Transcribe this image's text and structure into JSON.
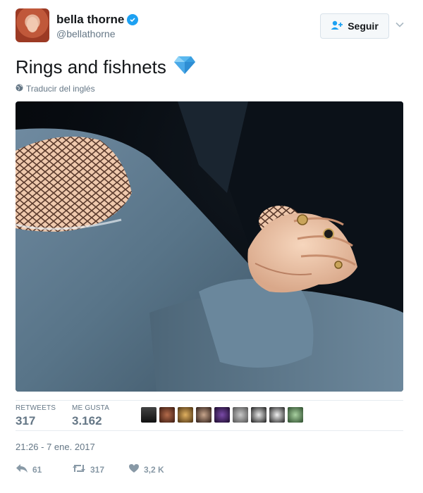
{
  "user": {
    "display_name": "bella thorne",
    "handle": "@bellathorne",
    "avatar_icon": "profile-avatar",
    "verified_icon": "verified-badge-icon"
  },
  "follow_button": {
    "label": "Seguir",
    "icon": "add-user-icon"
  },
  "tweet": {
    "text": "Rings and fishnets",
    "emoji": "💎",
    "translate_label": "Traducir del inglés"
  },
  "stats": {
    "retweets_label": "RETWEETS",
    "retweets_value": "317",
    "likes_label": "ME GUSTA",
    "likes_value": "3.162"
  },
  "timestamp": "21:26 - 7 ene. 2017",
  "actions": {
    "reply_count": "61",
    "retweet_count": "317",
    "like_count": "3,2 K"
  },
  "colors": {
    "brand_blue": "#1da1f2",
    "muted_text": "#657786",
    "action_gray": "#8899a6"
  }
}
